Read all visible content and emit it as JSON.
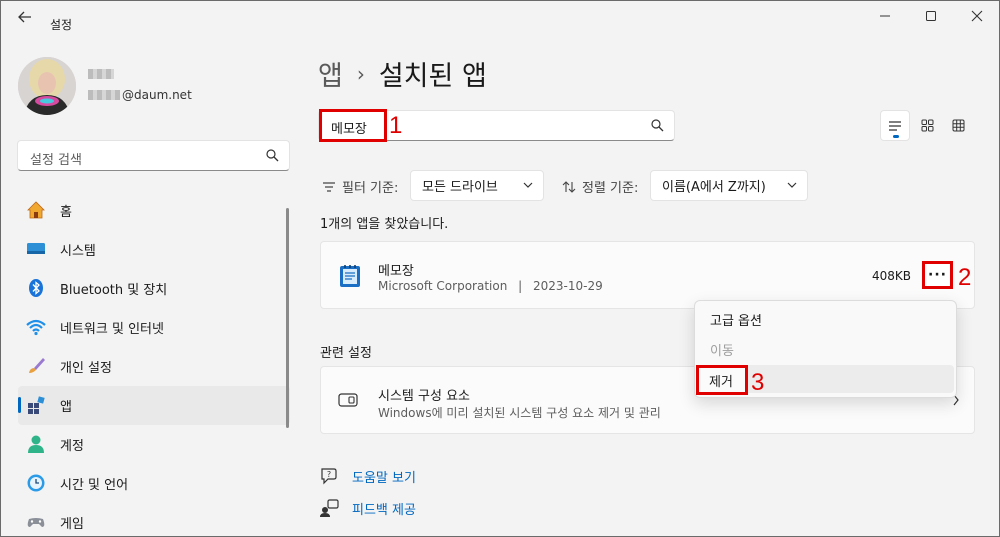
{
  "window": {
    "title": "설정"
  },
  "profile": {
    "email_suffix": "@daum.net"
  },
  "sidebar": {
    "search_placeholder": "설정 검색",
    "items": [
      {
        "label": "홈",
        "icon": "home-icon"
      },
      {
        "label": "시스템",
        "icon": "system-icon"
      },
      {
        "label": "Bluetooth 및 장치",
        "icon": "bluetooth-icon"
      },
      {
        "label": "네트워크 및 인터넷",
        "icon": "wifi-icon"
      },
      {
        "label": "개인 설정",
        "icon": "brush-icon"
      },
      {
        "label": "앱",
        "icon": "apps-icon",
        "selected": true
      },
      {
        "label": "계정",
        "icon": "account-icon"
      },
      {
        "label": "시간 및 언어",
        "icon": "time-language-icon"
      },
      {
        "label": "게임",
        "icon": "gaming-icon"
      }
    ]
  },
  "main": {
    "breadcrumb": {
      "parent": "앱",
      "separator": "›",
      "current": "설치된 앱"
    },
    "search": {
      "value": "메모장"
    },
    "filter": {
      "label": "필터 기준:",
      "value": "모든 드라이브"
    },
    "sort": {
      "label": "정렬 기준:",
      "value": "이름(A에서 Z까지)"
    },
    "result_count": "1개의 앱을 찾았습니다.",
    "app": {
      "name": "메모장",
      "publisher": "Microsoft Corporation",
      "separator": "|",
      "date": "2023-10-29",
      "size": "408KB",
      "more_label": "···"
    },
    "related": {
      "heading": "관련 설정",
      "title": "시스템 구성 요소",
      "description": "Windows에 미리 설치된 시스템 구성 요소 제거 및 관리"
    },
    "links": {
      "help": "도움말 보기",
      "feedback": "피드백 제공"
    }
  },
  "context_menu": {
    "items": [
      {
        "label": "고급 옵션",
        "enabled": true
      },
      {
        "label": "이동",
        "enabled": false
      },
      {
        "label": "제거",
        "enabled": true,
        "hovered": true
      }
    ]
  },
  "annotations": {
    "step1": "1",
    "step2": "2",
    "step3": "3",
    "color": "#e00000"
  },
  "colors": {
    "accent": "#0067c0",
    "background": "#f3f3f3"
  }
}
